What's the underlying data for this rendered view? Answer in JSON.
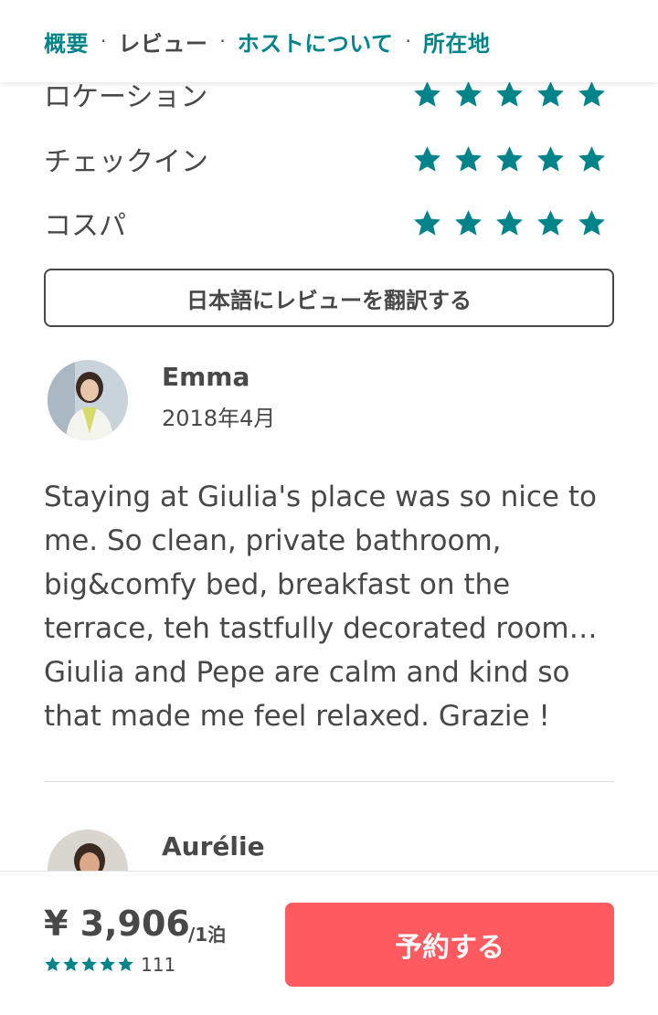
{
  "nav": {
    "items": [
      "概要",
      "レビュー",
      "ホストについて",
      "所在地"
    ],
    "separator": "·",
    "active_index": 1,
    "link_color": "#008489"
  },
  "ratings": [
    {
      "label": "ロケーション",
      "stars": 5
    },
    {
      "label": "チェックイン",
      "stars": 5
    },
    {
      "label": "コスパ",
      "stars": 5
    }
  ],
  "translate_button": "日本語にレビューを翻訳する",
  "reviews": [
    {
      "name": "Emma",
      "date": "2018年4月",
      "text": "Staying at Giulia's place was so nice to me. So clean, private bathroom, big&comfy bed, breakfast on the terrace, teh tastfully decorated room… Giulia and Pepe are calm and kind so that made me feel relaxed. Grazie !"
    },
    {
      "name": "Aurélie"
    }
  ],
  "booking": {
    "price": "¥ 3,906",
    "per_night": "/1泊",
    "stars": 5,
    "review_count": "111",
    "book_label": "予約する",
    "button_color": "#ff5a5f"
  }
}
